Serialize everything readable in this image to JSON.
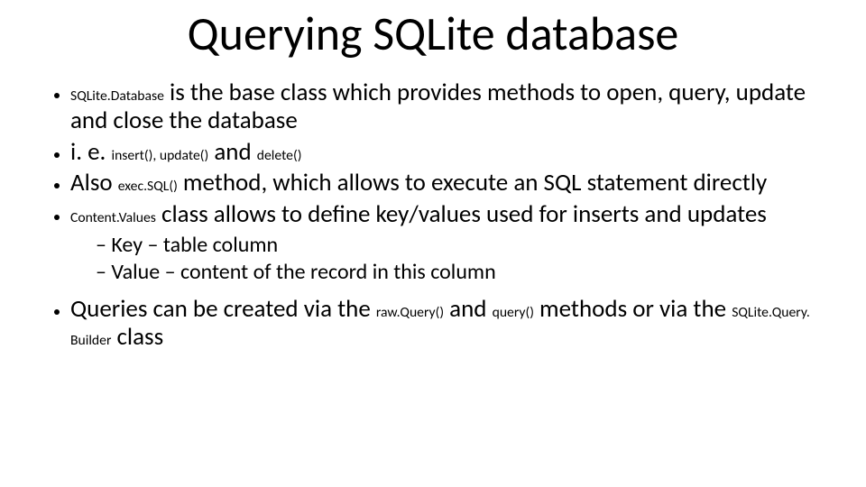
{
  "title": "Querying SQLite database",
  "bul1": {
    "code": "SQLite.Database",
    "rest": " is the base class which provides methods to open, query, update and close the database"
  },
  "bul2": {
    "pre": "i. e. ",
    "code1": "insert(), update()",
    "mid": " and ",
    "code2": "delete()"
  },
  "bul3": {
    "pre": "Also ",
    "code": "exec.SQL()",
    "rest": " method, which allows to execute an SQL statement directly"
  },
  "bul4": {
    "code": "Content.Values",
    "rest": " class allows to define key/values used for inserts and updates"
  },
  "sub1": "Key – table column",
  "sub2": "Value – content of the record in this column",
  "bul5": {
    "pre": "Queries can be created via the ",
    "code1": "raw.Query()",
    "mid1": " and ",
    "code2": "query()",
    "mid2": " methods or via the ",
    "code3": "SQLite.Query. Builder",
    "post": " class"
  }
}
